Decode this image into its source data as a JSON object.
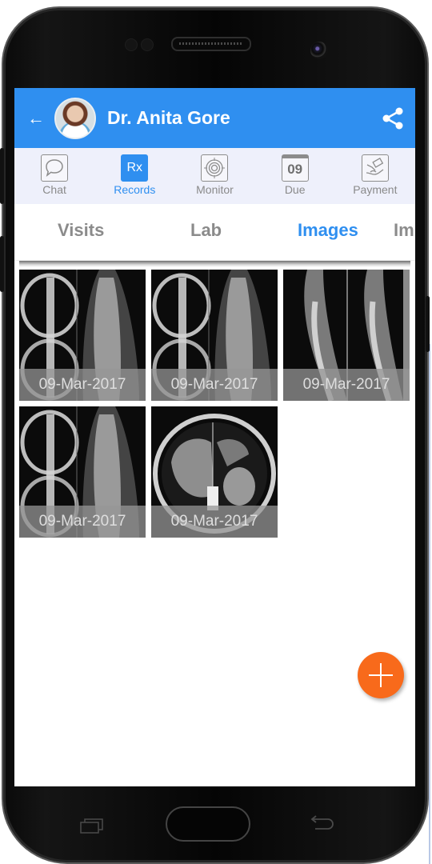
{
  "header": {
    "back_icon": "arrow-left-icon",
    "title": "Dr. Anita Gore",
    "share_icon": "share-icon",
    "color": "#2f8ff0"
  },
  "nav": {
    "items": [
      {
        "label": "Chat",
        "icon": "chat-bubble-icon",
        "active": false
      },
      {
        "label": "Records",
        "icon": "rx-icon",
        "icon_text": "Rx",
        "active": true
      },
      {
        "label": "Monitor",
        "icon": "target-icon",
        "active": false
      },
      {
        "label": "Due",
        "icon": "calendar-icon",
        "icon_text": "09",
        "active": false
      },
      {
        "label": "Payment",
        "icon": "payment-hand-icon",
        "active": false
      }
    ]
  },
  "tabs": {
    "items": [
      "Visits",
      "Lab",
      "Images",
      "Im"
    ],
    "active": "Images"
  },
  "images": [
    {
      "date": "09-Mar-2017",
      "type": "chest-ct-coronal"
    },
    {
      "date": "09-Mar-2017",
      "type": "chest-ct-coronal"
    },
    {
      "date": "09-Mar-2017",
      "type": "spine-mri-sagittal"
    },
    {
      "date": "09-Mar-2017",
      "type": "chest-ct-coronal"
    },
    {
      "date": "09-Mar-2017",
      "type": "abdomen-ct-axial"
    }
  ],
  "fab": {
    "icon": "plus-icon",
    "color": "#f86a1b"
  },
  "device": {
    "recent_icon": "recent-apps-icon",
    "home": "home-button",
    "back_icon": "back-icon"
  }
}
